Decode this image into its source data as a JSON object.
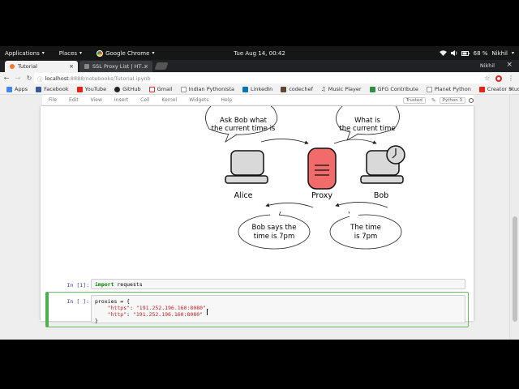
{
  "gnome": {
    "applications": "Applications",
    "places": "Places",
    "browser": "Google Chrome",
    "clock": "Tue Aug 14, 00:42",
    "battery": "68 %",
    "user": "Nikhil"
  },
  "tabs": [
    {
      "label": "Tutorial",
      "active": true
    },
    {
      "label": "SSL Proxy List | HT…",
      "active": false
    }
  ],
  "window_user": "Nikhil",
  "omnibox": {
    "host": "localhost",
    "path": ":8888/notebooks/Tutorial.ipynb"
  },
  "bookmarks": [
    {
      "label": "Apps",
      "icon": "apps-grid-icon",
      "color": "#4285f4"
    },
    {
      "label": "Facebook",
      "icon": "facebook-icon",
      "color": "#3b5998"
    },
    {
      "label": "YouTube",
      "icon": "youtube-icon",
      "color": "#e62117"
    },
    {
      "label": "GitHub",
      "icon": "github-icon",
      "color": "#222222"
    },
    {
      "label": "Gmail",
      "icon": "gmail-icon",
      "color": "#d93025"
    },
    {
      "label": "Indian Pythonista",
      "icon": "page-icon",
      "color": "#999999"
    },
    {
      "label": "LinkedIn",
      "icon": "linkedin-icon",
      "color": "#0077b5"
    },
    {
      "label": "codechef",
      "icon": "codechef-icon",
      "color": "#5b4638"
    },
    {
      "label": "Music Player",
      "icon": "headphones-icon",
      "color": "#333333"
    },
    {
      "label": "GFG Contribute",
      "icon": "gfg-icon",
      "color": "#2f8d46"
    },
    {
      "label": "Planet Python",
      "icon": "page-icon",
      "color": "#999999"
    },
    {
      "label": "Creator Studio",
      "icon": "youtube-icon",
      "color": "#e62117"
    }
  ],
  "notebook_menu": [
    "File",
    "Edit",
    "View",
    "Insert",
    "Cell",
    "Kernel",
    "Widgets",
    "Help"
  ],
  "notebook_status": {
    "trusted": "Trusted",
    "kernel": "Python 3"
  },
  "diagram": {
    "bubble_top_left": [
      "Ask Bob what",
      "the current time is"
    ],
    "bubble_top_right": [
      "What is",
      "the current time"
    ],
    "bubble_bottom_left": [
      "Bob says the",
      "time is 7pm"
    ],
    "bubble_bottom_right": [
      "The time",
      "is 7pm"
    ],
    "label_alice": "Alice",
    "label_proxy": "Proxy",
    "label_bob": "Bob",
    "proxy_color": "#f26b6b"
  },
  "cells": [
    {
      "prompt": "In [1]:",
      "code_kw": "import",
      "code_rest": " requests"
    },
    {
      "prompt": "In [ ]:",
      "line1": "proxies = {",
      "line2_key": "\"https\"",
      "line2_val": "\"191.252.196.160:8080\"",
      "line3_key": "\"http\"",
      "line3_val": "\"191.252.196.160:8080\"",
      "line4": "}"
    }
  ]
}
